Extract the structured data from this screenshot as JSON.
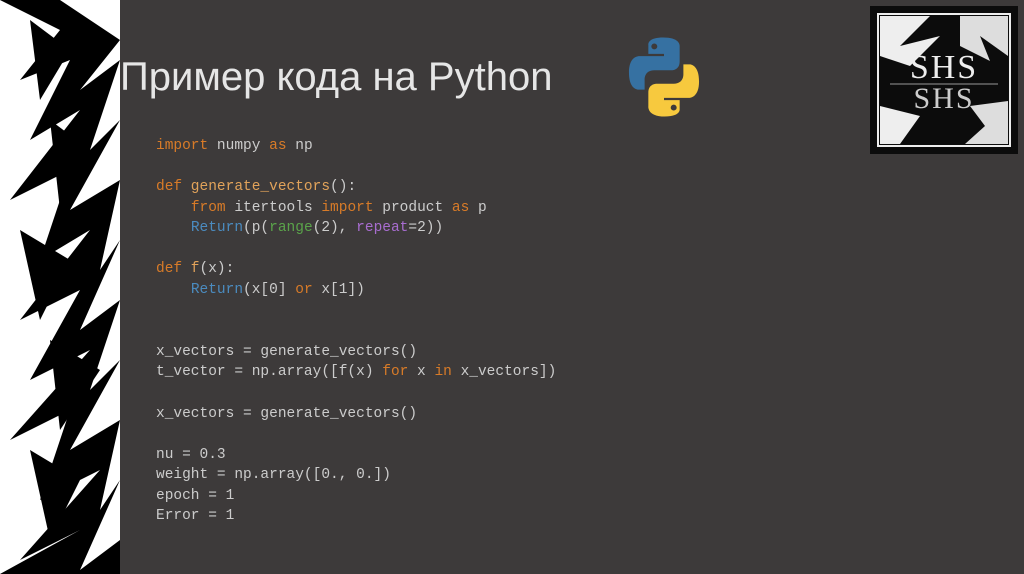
{
  "title": "Пример кода на Python",
  "icons": {
    "python": "python-logo",
    "badge": "shs-badge"
  },
  "code": {
    "l1_import": "import",
    "l1_numpy": " numpy ",
    "l1_as": "as",
    "l1_np": " np",
    "l3_def": "def",
    "l3_name": " generate_vectors",
    "l3_paren": "():",
    "l4_indent": "    ",
    "l4_from": "from",
    "l4_iter": " itertools ",
    "l4_import": "import",
    "l4_prod": " product ",
    "l4_as": "as",
    "l4_p": " p",
    "l5_indent": "    ",
    "l5_return": "Return",
    "l5_open": "(p(",
    "l5_range": "range",
    "l5_r2": "(2), ",
    "l5_repeat": "repeat",
    "l5_eq2": "=2))",
    "l7_def": "def",
    "l7_name": " f",
    "l7_paren": "(x):",
    "l8_indent": "    ",
    "l8_return": "Return",
    "l8_open": "(x[",
    "l8_zero": "0",
    "l8_mid": "] ",
    "l8_or": "or",
    "l8_x1a": " x[",
    "l8_one": "1",
    "l8_close": "])",
    "l11": "x_vectors = generate_vectors()",
    "l12a": "t_vector = np.array([f(x) ",
    "l12_for": "for",
    "l12_mid": " x ",
    "l12_in": "in",
    "l12_end": " x_vectors])",
    "l14": "x_vectors = generate_vectors()",
    "l16a": "nu = ",
    "l16b": "0.3",
    "l17a": "weight = np.array([",
    "l17b": "0.",
    "l17c": ", ",
    "l17d": "0.",
    "l17e": "])",
    "l18a": "epoch = ",
    "l18b": "1",
    "l19a": "Error = ",
    "l19b": "1"
  }
}
